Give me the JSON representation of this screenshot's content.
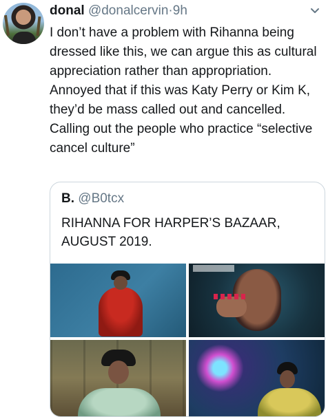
{
  "tweet": {
    "author_name": "donal",
    "author_handle": "@donalcervin",
    "separator": "·",
    "time": "9h",
    "text": "I don’t have a problem with Rihanna being dressed like this, we can argue this as cultural appreciation rather than appropriation. Annoyed that if this was Katy Perry or Kim K, they’d be mass called out and cancelled. Calling out the people who practice “selective cancel culture”"
  },
  "quoted_tweet": {
    "author_name": "B.",
    "author_handle": "@B0tcx",
    "text": "RIHANNA FOR HARPER’S BAZAAR, AUGUST 2019.",
    "media_count": 4
  },
  "icons": {
    "menu": "chevron-down-icon"
  },
  "colors": {
    "text_primary": "#14171a",
    "text_secondary": "#657786",
    "border": "#ccd6dd"
  }
}
